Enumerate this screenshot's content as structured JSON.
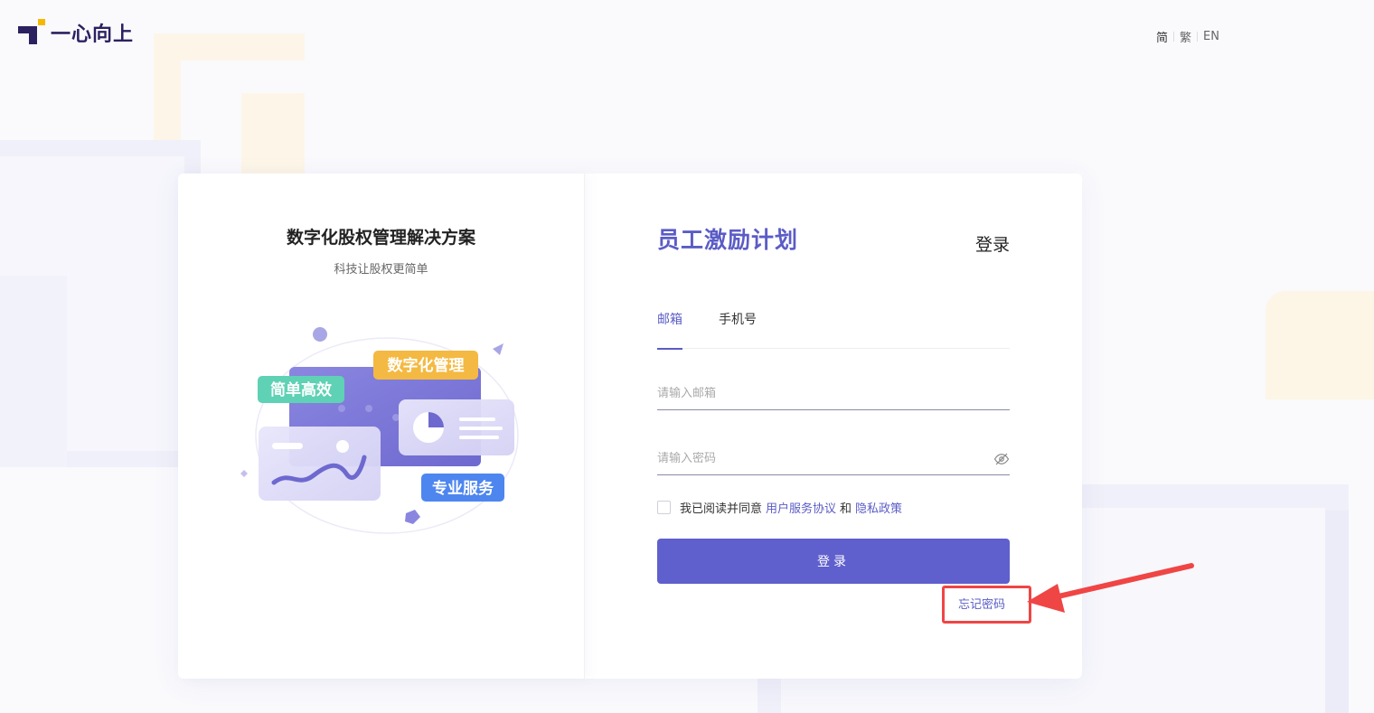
{
  "header": {
    "logo_text": "一心向上",
    "languages": [
      {
        "label": "简",
        "active": true
      },
      {
        "label": "繁",
        "active": false
      },
      {
        "label": "EN",
        "active": false
      }
    ]
  },
  "left_panel": {
    "title": "数字化股权管理解决方案",
    "subtitle": "科技让股权更简单",
    "illustration_tags": {
      "simple": "简单高效",
      "digital": "数字化管理",
      "pro": "专业服务"
    }
  },
  "login_panel": {
    "brand_title": "员工激励计划",
    "login_label": "登录",
    "tabs": [
      {
        "label": "邮箱",
        "active": true
      },
      {
        "label": "手机号",
        "active": false
      }
    ],
    "email_placeholder": "请输入邮箱",
    "password_placeholder": "请输入密码",
    "agree": {
      "prefix": "我已阅读并同意",
      "terms": "用户服务协议",
      "and": "和",
      "privacy": "隐私政策"
    },
    "submit_label": "登录",
    "forgot_label": "忘记密码"
  },
  "colors": {
    "brand": "#5b5cc6",
    "button": "#5f5fcd",
    "annotation": "#f04545",
    "logo": "#2b2160",
    "logo_accent": "#f5b800"
  }
}
